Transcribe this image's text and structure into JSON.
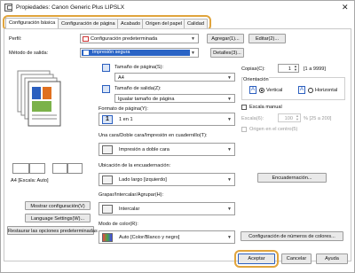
{
  "window": {
    "title": "Propiedades: Canon Generic Plus LIPSLX",
    "close_glyph": "✕"
  },
  "tabs": [
    {
      "label": "Configuración básica"
    },
    {
      "label": "Configuración de página"
    },
    {
      "label": "Acabado"
    },
    {
      "label": "Origen del papel"
    },
    {
      "label": "Calidad"
    }
  ],
  "profile": {
    "label": "Perfil:",
    "value": "Configuración predeterminada",
    "add_label": "Agregar(1)...",
    "edit_label": "Editar(2)..."
  },
  "output": {
    "label": "Método de salida:",
    "value": "Impresión segura",
    "details_label": "Detalles(3)..."
  },
  "page_size": {
    "label": "Tamaño de página(S):",
    "value": "A4"
  },
  "output_size": {
    "label": "Tamaño de salida(Z):",
    "value": "Igualar tamaño de página"
  },
  "copies": {
    "label": "Copias(C):",
    "value": "1",
    "range": "[1 a 9999]"
  },
  "orientation": {
    "label": "Orientación",
    "portrait": "Vertical",
    "landscape": "Horizontal",
    "portrait_letter": "A",
    "landscape_letter": "A"
  },
  "page_format": {
    "label": "Formato de página(Y):",
    "value": "1 en 1"
  },
  "manual_scale": {
    "label": "Escala manual",
    "scale_label": "Escala(6):",
    "scale_value": "100",
    "scale_range": "% [25 a 200]",
    "center_label": "Origen en el centro(5)"
  },
  "duplex": {
    "label": "Una cara/Doble cara/Impresión en cuadernillo(T):",
    "value": "Impresión a doble cara"
  },
  "binding": {
    "label": "Ubicación de la encuadernación:",
    "value": "Lado largo [izquierdo]",
    "button": "Encuadernación..."
  },
  "staple": {
    "label": "Grapar/Intercalar/Agrupar(H):",
    "value": "Intercalar"
  },
  "color": {
    "label": "Modo de color(R):",
    "value": "Auto [Color/Blanco y negro]",
    "button": "Configuración de números de colores..."
  },
  "preview": {
    "caption": "A4 [Escala: Auto]"
  },
  "left_buttons": {
    "show_settings": "Mostrar configuración(V)",
    "language": "Language Settings(W)...",
    "restore": "Restaurar las opciones predeterminadas"
  },
  "footer": {
    "accept": "Aceptar",
    "cancel": "Cancelar",
    "help": "Ayuda"
  },
  "colors": {
    "accent": "#e0a43c",
    "selection": "#2a64c5"
  }
}
